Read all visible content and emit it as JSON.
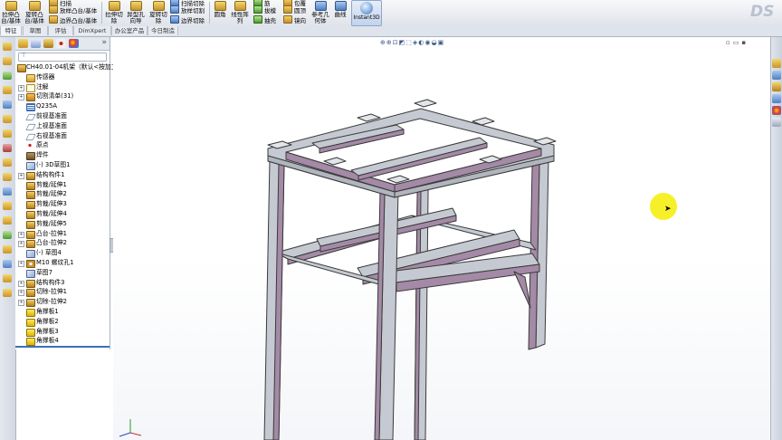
{
  "ribbon": {
    "buttons": [
      {
        "label": "拉伸凸台/基体",
        "short": "拉伸凸\n台/基体"
      },
      {
        "label": "旋转凸台/基体",
        "short": "旋转凸\n台/基体"
      },
      {
        "label": "扫描",
        "short": "扫描"
      },
      {
        "label": "放样凸台/基体",
        "short": "放样凸台/基体"
      },
      {
        "label": "边界凸台/基体",
        "short": "边界凸台/基体"
      },
      {
        "label": "拉伸切除",
        "short": "拉伸切\n除"
      },
      {
        "label": "异型孔向导",
        "short": "异型孔\n向导"
      },
      {
        "label": "旋转切除",
        "short": "旋转切\n除"
      },
      {
        "label": "扫描切除",
        "short": "扫描切除"
      },
      {
        "label": "放样切割",
        "short": "放样切割"
      },
      {
        "label": "边界切除",
        "short": "边界切除"
      },
      {
        "label": "圆角",
        "short": "圆角"
      },
      {
        "label": "线性阵列",
        "short": "线性阵\n列"
      },
      {
        "label": "筋",
        "short": "筋"
      },
      {
        "label": "拔模",
        "short": "拔模"
      },
      {
        "label": "抽壳",
        "short": "抽壳"
      },
      {
        "label": "包覆",
        "short": "包覆"
      },
      {
        "label": "圆顶",
        "short": "圆顶"
      },
      {
        "label": "镜向",
        "short": "镜向"
      },
      {
        "label": "参考几何体",
        "short": "参考几\n何体"
      },
      {
        "label": "曲线",
        "short": "曲线"
      },
      {
        "label": "Instant3D",
        "short": "Instant3D"
      }
    ]
  },
  "tabs": [
    "特征",
    "草图",
    "评估",
    "DimXpert",
    "办公室产品",
    "今日制造"
  ],
  "feature_tree": {
    "root": "CH40.01-04机架（默认<按加工>",
    "items": [
      {
        "label": "传感器",
        "icon": "sensor-icon",
        "expand": false
      },
      {
        "label": "注解",
        "icon": "annotation-icon",
        "expand": true
      },
      {
        "label": "切割清单(31)",
        "icon": "cut-list-icon",
        "expand": true
      },
      {
        "label": "Q235A",
        "icon": "material-icon",
        "expand": false
      },
      {
        "label": "前视基准面",
        "icon": "plane-icon",
        "expand": false
      },
      {
        "label": "上视基准面",
        "icon": "plane-icon",
        "expand": false
      },
      {
        "label": "右视基准面",
        "icon": "plane-icon",
        "expand": false
      },
      {
        "label": "原点",
        "icon": "origin-icon",
        "expand": false
      },
      {
        "label": "焊件",
        "icon": "weldment-icon",
        "expand": false
      },
      {
        "label": "(-) 3D草图1",
        "icon": "sketch-icon",
        "expand": false
      },
      {
        "label": "结构构件1",
        "icon": "feature-icon",
        "expand": true
      },
      {
        "label": "剪裁/延伸1",
        "icon": "feature-icon",
        "expand": false
      },
      {
        "label": "剪裁/延伸2",
        "icon": "feature-icon",
        "expand": false
      },
      {
        "label": "剪裁/延伸3",
        "icon": "feature-icon",
        "expand": false
      },
      {
        "label": "剪裁/延伸4",
        "icon": "feature-icon",
        "expand": false
      },
      {
        "label": "剪裁/延伸5",
        "icon": "feature-icon",
        "expand": false
      },
      {
        "label": "凸台-拉伸1",
        "icon": "feature-icon",
        "expand": true
      },
      {
        "label": "凸台-拉伸2",
        "icon": "feature-icon",
        "expand": true
      },
      {
        "label": "(-) 草图4",
        "icon": "sketch-icon",
        "expand": false
      },
      {
        "label": "M10 螺纹孔1",
        "icon": "hole-icon",
        "expand": true
      },
      {
        "label": "草图7",
        "icon": "sketch-icon",
        "expand": false
      },
      {
        "label": "结构构件3",
        "icon": "feature-icon",
        "expand": true
      },
      {
        "label": "切除-拉伸1",
        "icon": "feature-icon",
        "expand": true
      },
      {
        "label": "切除-拉伸2",
        "icon": "feature-icon",
        "expand": true
      },
      {
        "label": "角撑板1",
        "icon": "gusset-icon",
        "expand": false
      },
      {
        "label": "角撑板2",
        "icon": "gusset-icon",
        "expand": false
      },
      {
        "label": "角撑板3",
        "icon": "gusset-icon",
        "expand": false
      },
      {
        "label": "角撑板4",
        "icon": "gusset-icon",
        "expand": false
      }
    ]
  },
  "colors": {
    "frame_tube": "#c5c9d1",
    "frame_tube_inner": "#a48aa6",
    "frame_edge": "#3a3a3a",
    "cursor_highlight": "#f6ef1c",
    "accent": "#3c6fba"
  }
}
